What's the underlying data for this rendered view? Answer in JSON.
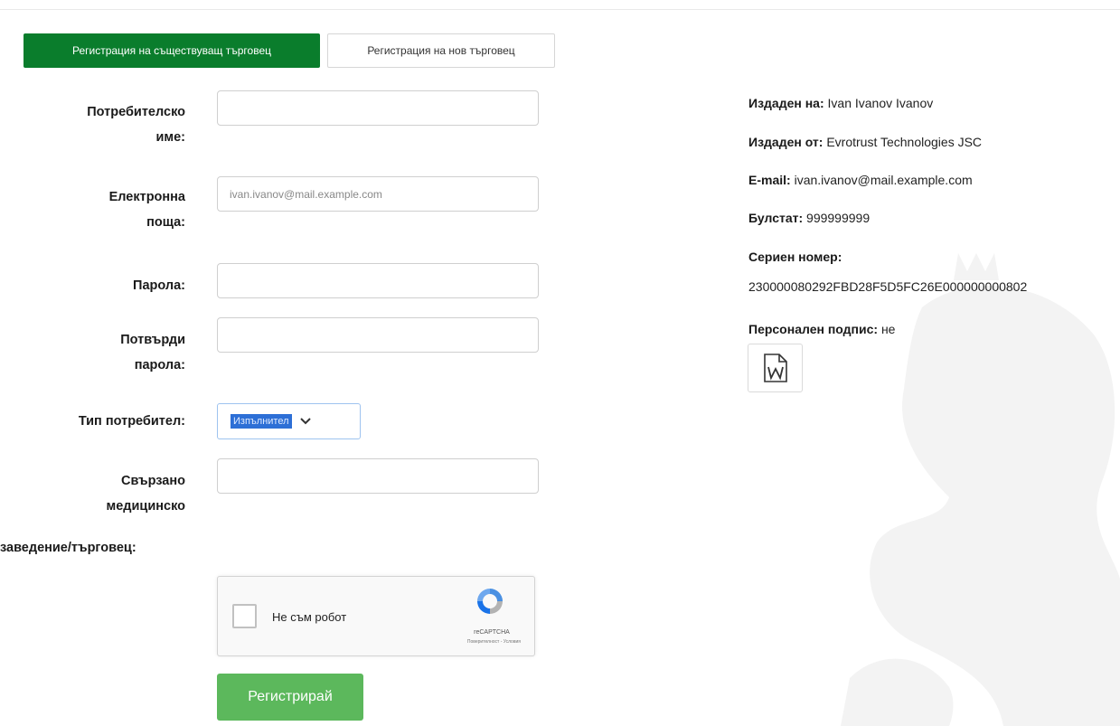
{
  "tabs": {
    "existing": "Регистрация на съществуващ търговец",
    "new": "Регистрация на нов търговец"
  },
  "form": {
    "username_label_1": "Потребителско",
    "username_label_2": "име:",
    "username_value": "",
    "email_label_1": "Електронна",
    "email_label_2": "поща:",
    "email_value": "ivan.ivanov@mail.example.com",
    "password_label": "Парола:",
    "password_value": "",
    "confirm_label_1": "Потвърди",
    "confirm_label_2": "парола:",
    "confirm_value": "",
    "usertype_label": "Тип потребител:",
    "usertype_selected": "Изпълнител",
    "linked_label_1": "Свързано",
    "linked_label_2": "медицинско",
    "linked_label_3": "заведение/търговец:",
    "linked_value": ""
  },
  "captcha": {
    "label": "Не съм робот",
    "brand": "reCAPTCHA",
    "links": "Поверителност - Условия"
  },
  "submit_label": "Регистрирай",
  "certificate": {
    "issued_to_label": "Издаден на:",
    "issued_to": "Ivan Ivanov Ivanov",
    "issued_by_label": "Издаден от:",
    "issued_by": "Evrotrust Technologies JSC",
    "email_label": "E-mail:",
    "email": "ivan.ivanov@mail.example.com",
    "bulstat_label": "Булстат:",
    "bulstat": "999999999",
    "serial_label": "Сериен номер:",
    "serial": "230000080292FBD28F5D5FC26E000000000802",
    "signature_label": "Персонален подпис:",
    "signature": "не"
  },
  "icons": {
    "doc": "word-document-icon",
    "captcha_logo": "recaptcha-logo-icon",
    "select_arrow": "chevron-down-icon"
  },
  "colors": {
    "active_tab": "#0a7d2c",
    "submit": "#5cb85c"
  }
}
